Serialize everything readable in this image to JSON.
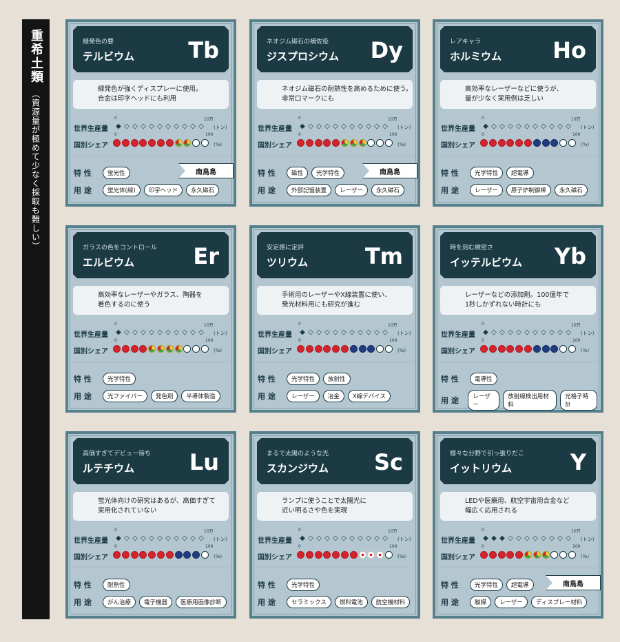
{
  "sidebar": {
    "title": "重希土類",
    "subtitle": "（資源量が極めて少なく採取も難しい）"
  },
  "labels": {
    "world_production": "世界生産量",
    "country_share": "国別シェア",
    "traits": "特 性",
    "uses": "用 途",
    "scale_start": "0",
    "production_scale_end": "10万",
    "share_scale_end": "100",
    "production_unit": "(トン)",
    "share_unit": "(%)"
  },
  "elements": [
    {
      "tagline": "緑発色の要",
      "name": "テルビウム",
      "symbol": "Tb",
      "description": [
        "緑発色が強くディスプレーに使用。",
        "合金は印字ヘッドにも利用"
      ],
      "production_level": 1,
      "share_dots": [
        "red",
        "red",
        "red",
        "red",
        "red",
        "red",
        "red",
        "mixed",
        "mixed",
        "empty",
        "empty"
      ],
      "traits": [
        "蛍光性"
      ],
      "uses": [
        "蛍光体(緑)",
        "印字ヘッド",
        "永久磁石"
      ],
      "origin": "南鳥島"
    },
    {
      "tagline": "ネオジム磁石の補佐役",
      "name": "ジスプロシウム",
      "symbol": "Dy",
      "description": [
        "ネオジム磁石の耐熱性を高めるために使う。",
        "非常口マークにも"
      ],
      "production_level": 1,
      "share_dots": [
        "red",
        "red",
        "red",
        "red",
        "red",
        "mixed",
        "mixed",
        "mixed",
        "empty",
        "empty",
        "empty"
      ],
      "traits": [
        "磁性",
        "光学特性"
      ],
      "uses": [
        "外部記憶装置",
        "レーザー",
        "永久磁石"
      ],
      "origin": "南鳥島"
    },
    {
      "tagline": "レアキャラ",
      "name": "ホルミウム",
      "symbol": "Ho",
      "description": [
        "高効率なレーザーなどに使うが、",
        "量が少なく実用例は乏しい"
      ],
      "production_level": 1,
      "share_dots": [
        "red",
        "red",
        "red",
        "red",
        "red",
        "red",
        "aus",
        "aus",
        "aus",
        "empty",
        "empty"
      ],
      "traits": [
        "光学特性",
        "超電導"
      ],
      "uses": [
        "レーザー",
        "原子炉制御棒",
        "永久磁石"
      ],
      "origin": ""
    },
    {
      "tagline": "ガラスの色をコントロール",
      "name": "エルビウム",
      "symbol": "Er",
      "description": [
        "高効率なレーザーやガラス、陶器を",
        "着色するのに使う"
      ],
      "production_level": 1,
      "share_dots": [
        "red",
        "red",
        "red",
        "red",
        "mixed",
        "mixed",
        "mixed",
        "mixed",
        "empty",
        "empty",
        "empty"
      ],
      "traits": [
        "光学特性"
      ],
      "uses": [
        "光ファイバー",
        "発色剤",
        "半導体製造"
      ],
      "origin": ""
    },
    {
      "tagline": "安定感に定評",
      "name": "ツリウム",
      "symbol": "Tm",
      "description": [
        "手術用のレーザーやX線装置に使い、",
        "発光材料用にも研究が進む"
      ],
      "production_level": 1,
      "share_dots": [
        "red",
        "red",
        "red",
        "red",
        "red",
        "red",
        "aus",
        "aus",
        "aus",
        "empty",
        "empty"
      ],
      "traits": [
        "光学特性",
        "放射性"
      ],
      "uses": [
        "レーザー",
        "冶金",
        "X線デバイス"
      ],
      "origin": ""
    },
    {
      "tagline": "時を刻む緻密さ",
      "name": "イッテルビウム",
      "symbol": "Yb",
      "description": [
        "レーザーなどの添加剤。100億年で",
        "1秒しかずれない時計にも"
      ],
      "production_level": 1,
      "share_dots": [
        "red",
        "red",
        "red",
        "red",
        "red",
        "red",
        "aus",
        "aus",
        "aus",
        "empty",
        "empty"
      ],
      "traits": [
        "電導性"
      ],
      "uses": [
        "レーザー",
        "放射線検出用材料",
        "光格子時計"
      ],
      "origin": ""
    },
    {
      "tagline": "高価すぎてデビュー待ち",
      "name": "ルテチウム",
      "symbol": "Lu",
      "description": [
        "蛍光体向けの研究はあるが、高価すぎて",
        "実用化されていない"
      ],
      "production_level": 1,
      "share_dots": [
        "red",
        "red",
        "red",
        "red",
        "red",
        "red",
        "red",
        "aus",
        "aus",
        "aus",
        "empty"
      ],
      "traits": [
        "耐熱性"
      ],
      "uses": [
        "がん治療",
        "電子機器",
        "医療用画像診断"
      ],
      "origin": ""
    },
    {
      "tagline": "まるで太陽のような光",
      "name": "スカンジウム",
      "symbol": "Sc",
      "description": [
        "ランプに使うことで太陽光に",
        "近い明るさや色を実現"
      ],
      "production_level": 1,
      "share_dots": [
        "red",
        "red",
        "red",
        "red",
        "red",
        "red",
        "red",
        "japan",
        "japan",
        "japan",
        "empty"
      ],
      "traits": [
        "光学特性"
      ],
      "uses": [
        "セラミックス",
        "燃料電池",
        "航空機材料"
      ],
      "origin": ""
    },
    {
      "tagline": "様々な分野で引っ張りだこ",
      "name": "イットリウム",
      "symbol": "Y",
      "description": [
        "LEDや医療用、航空宇宙用合金など",
        "幅広く応用される"
      ],
      "production_level": 3,
      "share_dots": [
        "red",
        "red",
        "red",
        "red",
        "red",
        "mixed",
        "mixed",
        "mixed",
        "empty",
        "empty",
        "empty"
      ],
      "traits": [
        "光学特性",
        "超電導"
      ],
      "uses": [
        "触媒",
        "レーザー",
        "ディスプレー材料"
      ],
      "origin": "南鳥島"
    }
  ]
}
